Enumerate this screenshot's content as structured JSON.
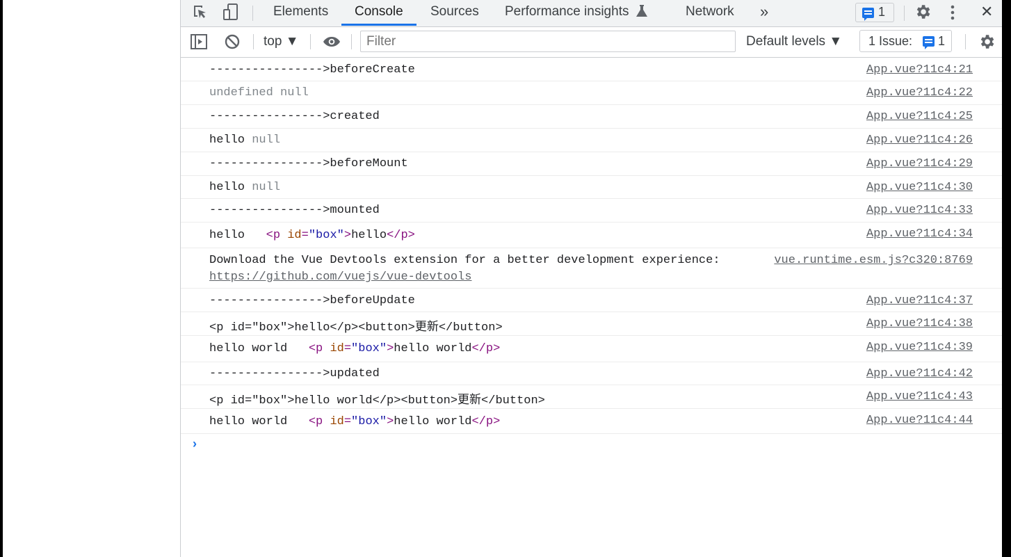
{
  "tabs": [
    {
      "label": "Elements"
    },
    {
      "label": "Console"
    },
    {
      "label": "Sources"
    },
    {
      "label": "Performance insights"
    },
    {
      "label": "Network"
    }
  ],
  "tabbar": {
    "overflow": "»",
    "message_count": "1",
    "close": "✕"
  },
  "toolbar": {
    "context": "top ▼",
    "filter_placeholder": "Filter",
    "levels": "Default levels ▼",
    "issues_label": "1 Issue:",
    "issues_count": "1"
  },
  "console": {
    "rows": [
      {
        "msg": "---------------->beforeCreate",
        "src": "App.vue?11c4:21"
      },
      {
        "msg": "undefined null",
        "src": "App.vue?11c4:22"
      },
      {
        "msg": "---------------->created",
        "src": "App.vue?11c4:25"
      },
      {
        "msg_a": "hello",
        "msg_b": "null",
        "src": "App.vue?11c4:26"
      },
      {
        "msg": "---------------->beforeMount",
        "src": "App.vue?11c4:29"
      },
      {
        "msg_a": "hello",
        "msg_b": "null",
        "src": "App.vue?11c4:30"
      },
      {
        "msg": "---------------->mounted",
        "src": "App.vue?11c4:33"
      },
      {
        "msg_a": "hello",
        "tag_open": "<p",
        "attr": "id",
        "eq": "=",
        "val": "\"box\"",
        "gt": ">",
        "text": "hello",
        "tag_close": "</p>",
        "src": "App.vue?11c4:34"
      },
      {
        "msg": "Download the Vue Devtools extension for a better development experience:",
        "link": "https://github.com/vuejs/vue-devtools",
        "src": "vue.runtime.esm.js?c320:8769"
      },
      {
        "msg": "---------------->beforeUpdate",
        "src": "App.vue?11c4:37"
      },
      {
        "msg": "<p id=\"box\">hello</p><button>更新</button>",
        "src": "App.vue?11c4:38"
      },
      {
        "msg_a": "hello world",
        "tag_open": "<p",
        "attr": "id",
        "eq": "=",
        "val": "\"box\"",
        "gt": ">",
        "text": "hello world",
        "tag_close": "</p>",
        "src": "App.vue?11c4:39"
      },
      {
        "msg": "---------------->updated",
        "src": "App.vue?11c4:42"
      },
      {
        "msg": "<p id=\"box\">hello world</p><button>更新</button>",
        "src": "App.vue?11c4:43"
      },
      {
        "msg_a": "hello world",
        "tag_open": "<p",
        "attr": "id",
        "eq": "=",
        "val": "\"box\"",
        "gt": ">",
        "text": "hello world",
        "tag_close": "</p>",
        "src": "App.vue?11c4:44"
      }
    ],
    "prompt": "›"
  }
}
